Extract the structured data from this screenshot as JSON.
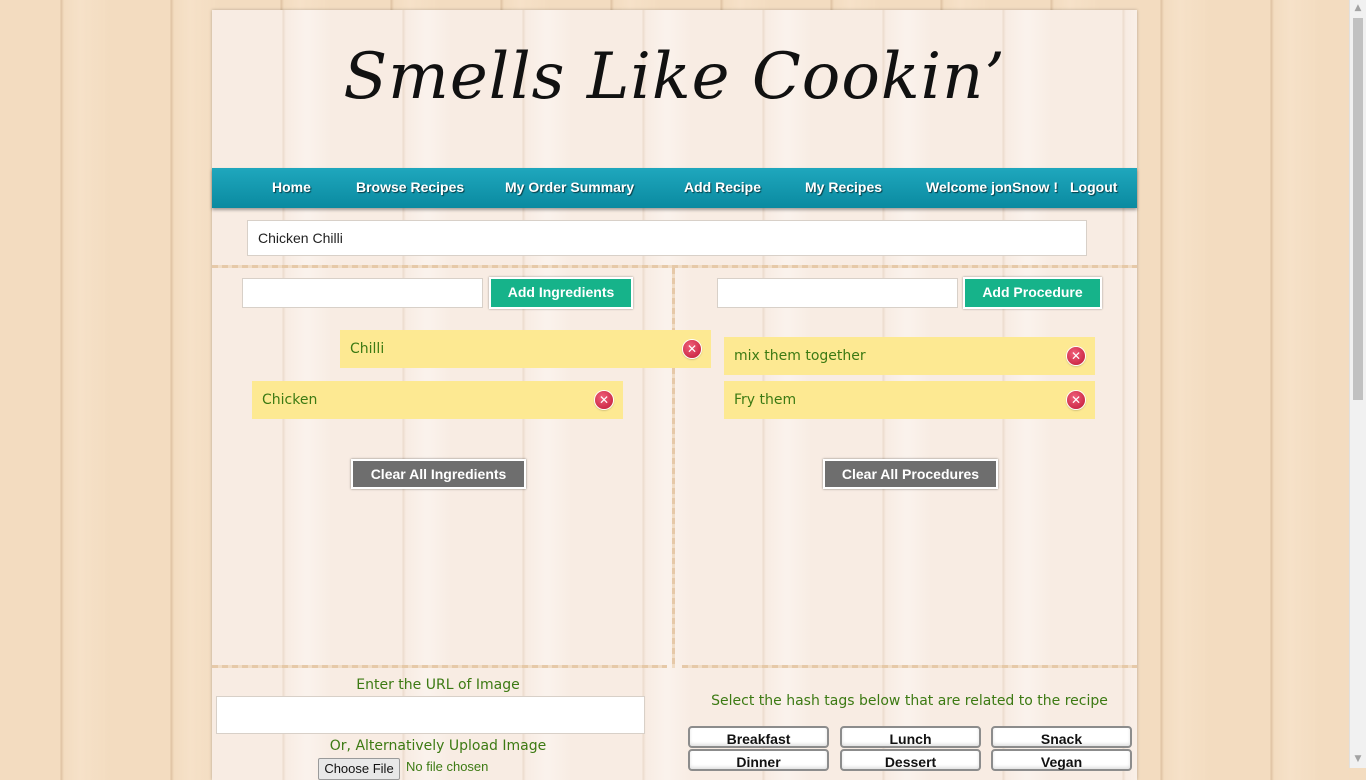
{
  "app": {
    "logo_text": "Smells Like Cookin’"
  },
  "nav": {
    "items": [
      {
        "label": "Home"
      },
      {
        "label": "Browse Recipes"
      },
      {
        "label": "My Order Summary"
      },
      {
        "label": "Add Recipe"
      },
      {
        "label": "My Recipes"
      },
      {
        "label": "Welcome jonSnow !"
      },
      {
        "label": "Logout"
      }
    ]
  },
  "recipe": {
    "title_value": "Chicken Chilli"
  },
  "ingredients": {
    "input_value": "",
    "add_label": "Add Ingredients",
    "items": [
      {
        "label": "Chilli"
      },
      {
        "label": "Chicken"
      }
    ],
    "clear_label": "Clear All Ingredients"
  },
  "procedures": {
    "input_value": "",
    "add_label": "Add Procedure",
    "items": [
      {
        "label": "mix them together"
      },
      {
        "label": "Fry them"
      }
    ],
    "clear_label": "Clear All Procedures"
  },
  "image": {
    "url_label": "Enter the URL of Image",
    "url_value": "",
    "upload_label": "Or, Alternatively Upload Image",
    "file_button_label": "Choose File",
    "file_status": "No file chosen"
  },
  "hashtags": {
    "prompt": "Select the hash tags below that are related to the recipe",
    "tags": [
      {
        "label": "Breakfast"
      },
      {
        "label": "Lunch"
      },
      {
        "label": "Snack"
      },
      {
        "label": "Dinner"
      },
      {
        "label": "Dessert"
      },
      {
        "label": "Vegan"
      }
    ]
  },
  "colors": {
    "nav_bar": "#0a8aa0",
    "accent_button": "#16b38a",
    "item_background": "#fde992",
    "item_text": "#3c7a13",
    "remove_icon": "#c01636",
    "clear_button": "#6e6e6e"
  },
  "icons": {
    "remove": "remove-circle-icon"
  }
}
